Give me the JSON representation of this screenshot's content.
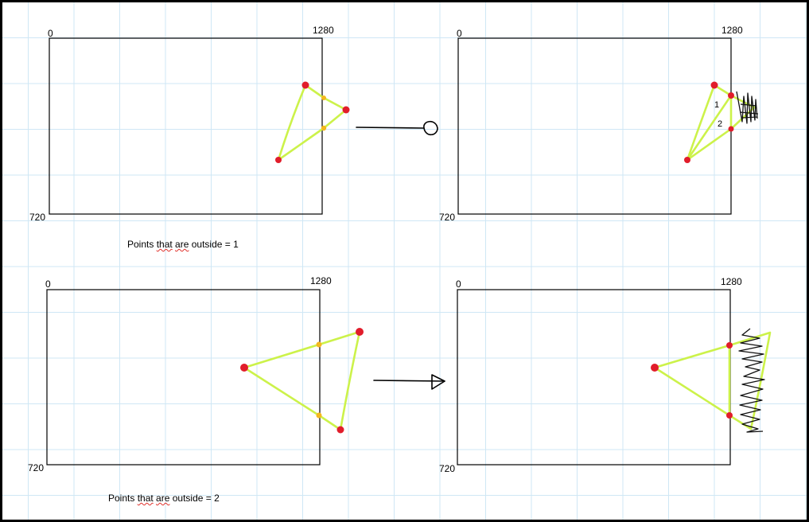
{
  "colors": {
    "grid_line": "#cfe7f5",
    "frame": "#000000",
    "triangle": "#ccf24a",
    "point_inside_screen_edge": "#f4b81d",
    "point": "#e11d2b",
    "scribble": "#111111"
  },
  "panels": [
    {
      "label_origin": "0",
      "label_width": "1280",
      "label_height": "720",
      "caption_pre": "Points ",
      "caption_typo1": "that",
      "caption_mid": " ",
      "caption_typo2": "are",
      "caption_post": " outside = 1"
    },
    {
      "label_origin": "0",
      "label_width": "1280",
      "label_height": "720",
      "number_1": "1",
      "number_2": "2"
    },
    {
      "label_origin": "0",
      "label_width": "1280",
      "label_height": "720",
      "caption_pre": "Points ",
      "caption_typo1": "that",
      "caption_mid": " ",
      "caption_typo2": "are",
      "caption_post": " outside = 2"
    },
    {
      "label_origin": "0",
      "label_width": "1280",
      "label_height": "720"
    }
  ],
  "icons": {
    "arrow_top": "arrow-right-icon",
    "arrow_bottom": "arrow-right-icon",
    "scribble_top": "hatch-scribble-icon",
    "scribble_bottom": "hatch-scribble-icon"
  }
}
